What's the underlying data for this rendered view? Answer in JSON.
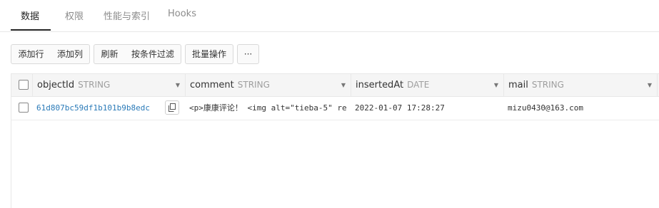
{
  "tabs": [
    {
      "label": "数据"
    },
    {
      "label": "权限"
    },
    {
      "label": "性能与索引"
    },
    {
      "label": "Hooks"
    }
  ],
  "toolbar": {
    "add_row": "添加行",
    "add_column": "添加列",
    "refresh": "刷新",
    "filter": "按条件过滤",
    "batch": "批量操作",
    "more": "···"
  },
  "table": {
    "columns": [
      {
        "name": "objectId",
        "type": "STRING"
      },
      {
        "name": "comment",
        "type": "STRING"
      },
      {
        "name": "insertedAt",
        "type": "DATE"
      },
      {
        "name": "mail",
        "type": "STRING"
      }
    ],
    "rows": [
      {
        "objectId": "61d807bc59df1b101b9b8edc",
        "comment": "<p>康康评论！ <img alt=\"tieba-5\" re",
        "insertedAt": "2022-01-07 17:28:27",
        "mail": "mizu0430@163.com"
      }
    ]
  },
  "icons": {
    "dropdown": "caret-down-icon",
    "copy": "copy-icon"
  }
}
